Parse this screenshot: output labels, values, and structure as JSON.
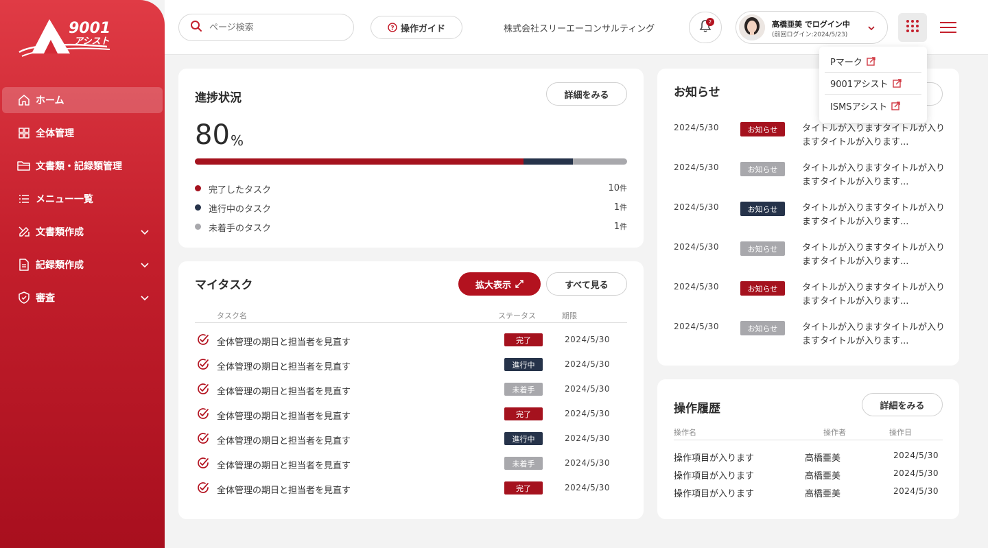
{
  "brand": {
    "logo_text": "9001",
    "logo_sub": "アシスト"
  },
  "sidebar": {
    "items": [
      {
        "label": "ホーム",
        "icon": "home-icon",
        "active": true,
        "expandable": false
      },
      {
        "label": "全体管理",
        "icon": "grid-icon",
        "active": false,
        "expandable": false
      },
      {
        "label": "文書類・記録類管理",
        "icon": "folder-icon",
        "active": false,
        "expandable": false
      },
      {
        "label": "メニュー一覧",
        "icon": "list-icon",
        "active": false,
        "expandable": false
      },
      {
        "label": "文書類作成",
        "icon": "pencil-ruler-icon",
        "active": false,
        "expandable": true
      },
      {
        "label": "記録類作成",
        "icon": "document-icon",
        "active": false,
        "expandable": true
      },
      {
        "label": "審査",
        "icon": "shield-check-icon",
        "active": false,
        "expandable": true
      }
    ]
  },
  "header": {
    "search_placeholder": "ページ検索",
    "guide_label": "操作ガイド",
    "company": "株式会社スリーエーコンサルティング",
    "notification_count": "2",
    "user_name": "高橋亜美 でログイン中",
    "last_login": "(前回ログイン:2024/5/23)"
  },
  "dropdown": {
    "items": [
      {
        "label": "Pマーク"
      },
      {
        "label": "9001アシスト"
      },
      {
        "label": "ISMSアシスト"
      }
    ]
  },
  "progress": {
    "title": "進捗状況",
    "detail_label": "詳細をみる",
    "percent": "80",
    "percent_unit": "%",
    "legend": [
      {
        "label": "完了したタスク",
        "count": "10",
        "unit": "件",
        "color": "#a5121e"
      },
      {
        "label": "進行中のタスク",
        "count": "1",
        "unit": "件",
        "color": "#26334a"
      },
      {
        "label": "未着手のタスク",
        "count": "1",
        "unit": "件",
        "color": "#a8a8ac"
      }
    ]
  },
  "tasks": {
    "title": "マイタスク",
    "expand_label": "拡大表示",
    "see_all_label": "すべて見る",
    "columns": [
      "タスク名",
      "ステータス",
      "期限"
    ],
    "rows": [
      {
        "name": "全体管理の期日と担当者を見直す",
        "status": "完了",
        "due": "2024/5/30"
      },
      {
        "name": "全体管理の期日と担当者を見直す",
        "status": "進行中",
        "due": "2024/5/30"
      },
      {
        "name": "全体管理の期日と担当者を見直す",
        "status": "未着手",
        "due": "2024/5/30"
      },
      {
        "name": "全体管理の期日と担当者を見直す",
        "status": "完了",
        "due": "2024/5/30"
      },
      {
        "name": "全体管理の期日と担当者を見直す",
        "status": "進行中",
        "due": "2024/5/30"
      },
      {
        "name": "全体管理の期日と担当者を見直す",
        "status": "未着手",
        "due": "2024/5/30"
      },
      {
        "name": "全体管理の期日と担当者を見直す",
        "status": "完了",
        "due": "2024/5/30"
      }
    ]
  },
  "status_colors": {
    "完了": "#a5121e",
    "進行中": "#26334a",
    "未着手": "#a8a8ac"
  },
  "news": {
    "title": "お知らせ",
    "items": [
      {
        "date": "2024/5/30",
        "tag": "お知らせ",
        "tag_color": "#a5121e",
        "text": "タイトルが入りますタイトルが入りますタイトルが入ります..."
      },
      {
        "date": "2024/5/30",
        "tag": "お知らせ",
        "tag_color": "#a8a8ac",
        "text": "タイトルが入りますタイトルが入りますタイトルが入ります..."
      },
      {
        "date": "2024/5/30",
        "tag": "お知らせ",
        "tag_color": "#26334a",
        "text": "タイトルが入りますタイトルが入りますタイトルが入ります..."
      },
      {
        "date": "2024/5/30",
        "tag": "お知らせ",
        "tag_color": "#a8a8ac",
        "text": "タイトルが入りますタイトルが入りますタイトルが入ります..."
      },
      {
        "date": "2024/5/30",
        "tag": "お知らせ",
        "tag_color": "#a5121e",
        "text": "タイトルが入りますタイトルが入りますタイトルが入ります..."
      },
      {
        "date": "2024/5/30",
        "tag": "お知らせ",
        "tag_color": "#a8a8ac",
        "text": "タイトルが入りますタイトルが入りますタイトルが入ります..."
      }
    ]
  },
  "history": {
    "title": "操作履歴",
    "detail_label": "詳細をみる",
    "columns": [
      "操作名",
      "操作者",
      "操作日"
    ],
    "rows": [
      {
        "action": "操作項目が入ります",
        "user": "高橋亜美",
        "date": "2024/5/30"
      },
      {
        "action": "操作項目が入ります",
        "user": "高橋亜美",
        "date": "2024/5/30"
      },
      {
        "action": "操作項目が入ります",
        "user": "高橋亜美",
        "date": "2024/5/30"
      }
    ]
  }
}
